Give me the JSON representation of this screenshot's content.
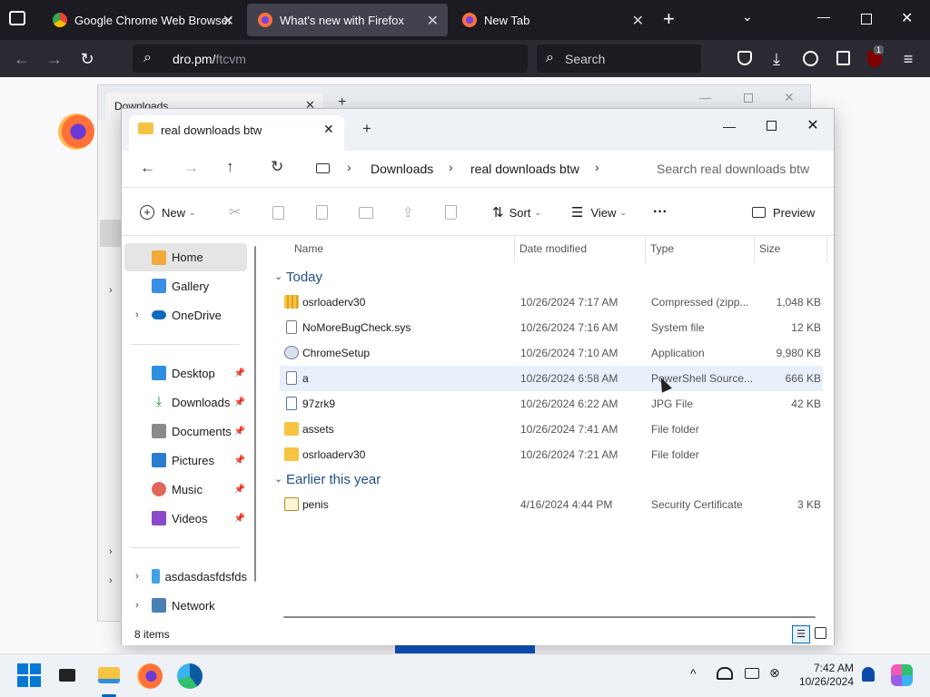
{
  "browser": {
    "tabs": [
      {
        "label": "Google Chrome Web Browser"
      },
      {
        "label": "What's new with Firefox"
      },
      {
        "label": "New Tab"
      }
    ],
    "url_host": "dro.pm/",
    "url_path": "ftcvm",
    "search_placeholder": "Search",
    "badge_count": "1"
  },
  "bg_window": {
    "tab_label": "Downloads"
  },
  "explorer": {
    "tab_label": "real downloads btw",
    "breadcrumb": [
      "Downloads",
      "real downloads btw"
    ],
    "search_placeholder": "Search real downloads btw",
    "toolbar": {
      "new_label": "New",
      "sort_label": "Sort",
      "view_label": "View",
      "more_label": "···",
      "preview_label": "Preview"
    },
    "nav": {
      "home": "Home",
      "gallery": "Gallery",
      "onedrive": "OneDrive",
      "desktop": "Desktop",
      "downloads": "Downloads",
      "documents": "Documents",
      "pictures": "Pictures",
      "music": "Music",
      "videos": "Videos",
      "pc": "asdasdasfdsfds",
      "network": "Network"
    },
    "columns": {
      "name": "Name",
      "date": "Date modified",
      "type": "Type",
      "size": "Size"
    },
    "groups": {
      "today": "Today",
      "earlier": "Earlier this year"
    },
    "files_today": [
      {
        "name": "osrloaderv30",
        "date": "10/26/2024 7:17 AM",
        "type": "Compressed (zipp...",
        "size": "1,048 KB",
        "icon": "zip-folder-icon"
      },
      {
        "name": "NoMoreBugCheck.sys",
        "date": "10/26/2024 7:16 AM",
        "type": "System file",
        "size": "12 KB",
        "icon": "system-file-icon"
      },
      {
        "name": "ChromeSetup",
        "date": "10/26/2024 7:10 AM",
        "type": "Application",
        "size": "9,980 KB",
        "icon": "application-icon"
      },
      {
        "name": "a",
        "date": "10/26/2024 6:58 AM",
        "type": "PowerShell Source...",
        "size": "666 KB",
        "icon": "powershell-file-icon"
      },
      {
        "name": "97zrk9",
        "date": "10/26/2024 6:22 AM",
        "type": "JPG File",
        "size": "42 KB",
        "icon": "image-file-icon"
      },
      {
        "name": "assets",
        "date": "10/26/2024 7:41 AM",
        "type": "File folder",
        "size": "",
        "icon": "folder-icon"
      },
      {
        "name": "osrloaderv30",
        "date": "10/26/2024 7:21 AM",
        "type": "File folder",
        "size": "",
        "icon": "folder-icon"
      }
    ],
    "files_earlier": [
      {
        "name": "penis",
        "date": "4/16/2024 4:44 PM",
        "type": "Security Certificate",
        "size": "3 KB",
        "icon": "certificate-icon"
      }
    ],
    "status": "8 items"
  },
  "taskbar": {
    "time": "7:42 AM",
    "date": "10/26/2024"
  },
  "colors": {
    "accent": "#0067c0",
    "folder": "#f6c343",
    "firefox_dark": "#1c1b22"
  }
}
